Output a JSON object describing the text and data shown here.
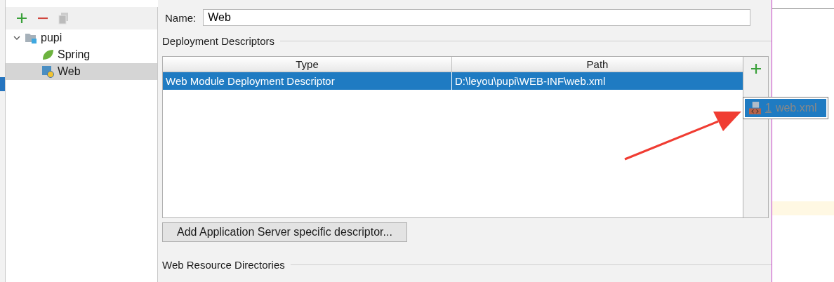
{
  "tree": {
    "items": [
      {
        "label": "pupi",
        "kind": "module",
        "expanded": true,
        "selected": false,
        "children": [
          {
            "label": "Spring",
            "kind": "spring",
            "selected": false
          },
          {
            "label": "Web",
            "kind": "web",
            "selected": true
          }
        ]
      }
    ]
  },
  "name_field": {
    "label": "Name:",
    "value": "Web"
  },
  "descriptors": {
    "title": "Deployment Descriptors",
    "columns": [
      "Type",
      "Path"
    ],
    "rows": [
      {
        "type": "Web Module Deployment Descriptor",
        "path": "D:\\leyou\\pupi\\WEB-INF\\web.xml",
        "selected": true
      }
    ],
    "popup": [
      {
        "index": "1",
        "label": "web.xml",
        "selected": true
      }
    ]
  },
  "add_button": "Add Application Server specific descriptor...",
  "resources_title": "Web Resource Directories"
}
